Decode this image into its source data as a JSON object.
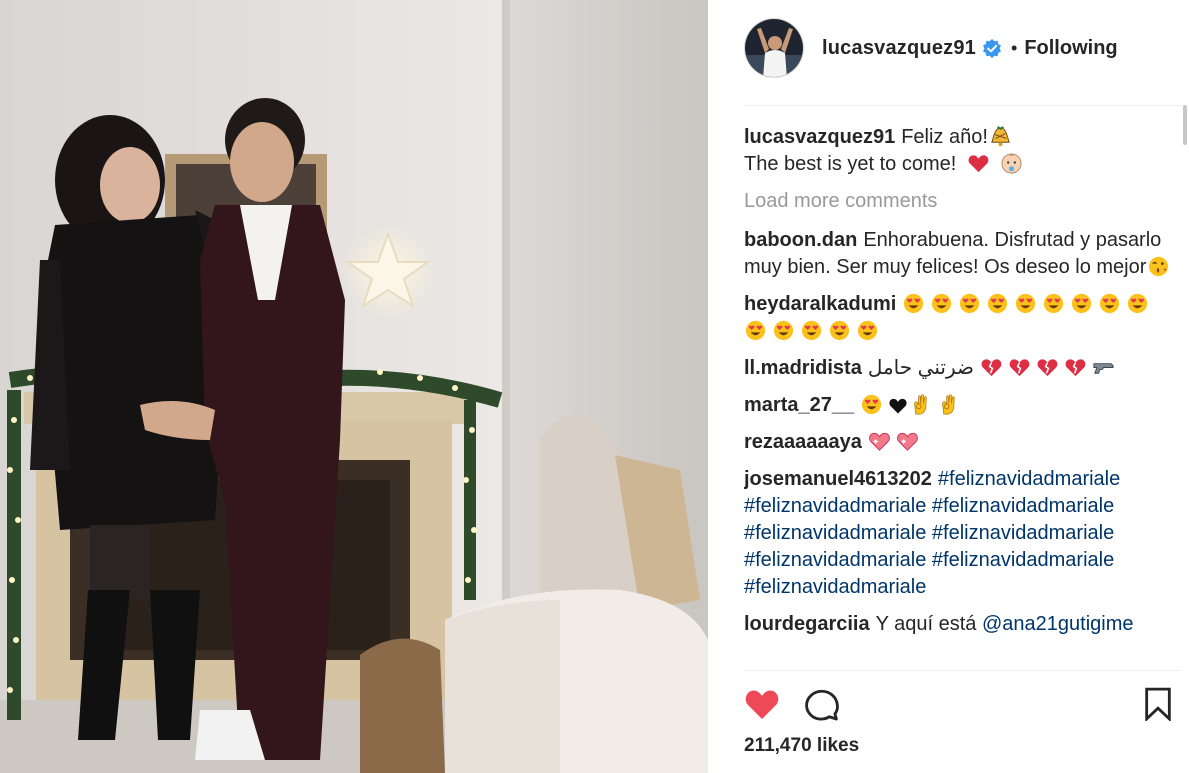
{
  "header": {
    "username": "lucasvazquez91",
    "verified": true,
    "separator": "•",
    "follow_state": "Following"
  },
  "caption": {
    "user": "lucasvazquez91",
    "line1": "Feliz año!",
    "line2": "The best is yet to come!",
    "emoji": [
      "champagne-bell-icon",
      "red-heart-icon",
      "baby-face-icon"
    ]
  },
  "load_more_label": "Load more comments",
  "comments": [
    {
      "user": "baboon.dan",
      "text": "Enhorabuena. Disfrutad y pasarlo muy bien. Ser muy felices! Os deseo lo mejor",
      "emoji": [
        "kissing-wink-face-icon"
      ]
    },
    {
      "user": "heydaralkadumi",
      "text": "",
      "emoji_count": 14,
      "emoji": "heart-eyes-face-icon"
    },
    {
      "user": "ll.madridista",
      "text": "ضرتني حامل",
      "emoji": [
        "broken-heart-icon",
        "broken-heart-icon",
        "broken-heart-icon",
        "broken-heart-icon",
        "pistol-icon"
      ]
    },
    {
      "user": "marta_27__",
      "text": "",
      "emoji": [
        "heart-eyes-face-icon",
        "black-heart-icon",
        "ok-hand-icon",
        "ok-hand-icon"
      ]
    },
    {
      "user": "rezaaaaaaya",
      "text": "",
      "emoji": [
        "sparkling-heart-icon",
        "sparkling-heart-icon"
      ]
    },
    {
      "user": "josemanuel4613202",
      "hashtags": [
        "#feliznavidadmariale",
        "#feliznavidadmariale",
        "#feliznavidadmariale",
        "#feliznavidadmariale",
        "#feliznavidadmariale",
        "#feliznavidadmariale",
        "#feliznavidadmariale",
        "#feliznavidadmariale"
      ]
    },
    {
      "user": "lourdegarciia",
      "text": "Y aquí está",
      "mention": "@ana21gutigime"
    }
  ],
  "actions": {
    "like": {
      "icon": "heart-filled-icon",
      "active": true,
      "color": "#ed4956"
    },
    "comment": {
      "icon": "comment-bubble-icon"
    },
    "save": {
      "icon": "bookmark-icon"
    }
  },
  "likes_label": "211,470 likes",
  "colors": {
    "text": "#262626",
    "muted": "#999999",
    "link": "#003569",
    "like_red": "#ed4956",
    "verified_blue": "#3897f0",
    "divider": "#efefef"
  }
}
